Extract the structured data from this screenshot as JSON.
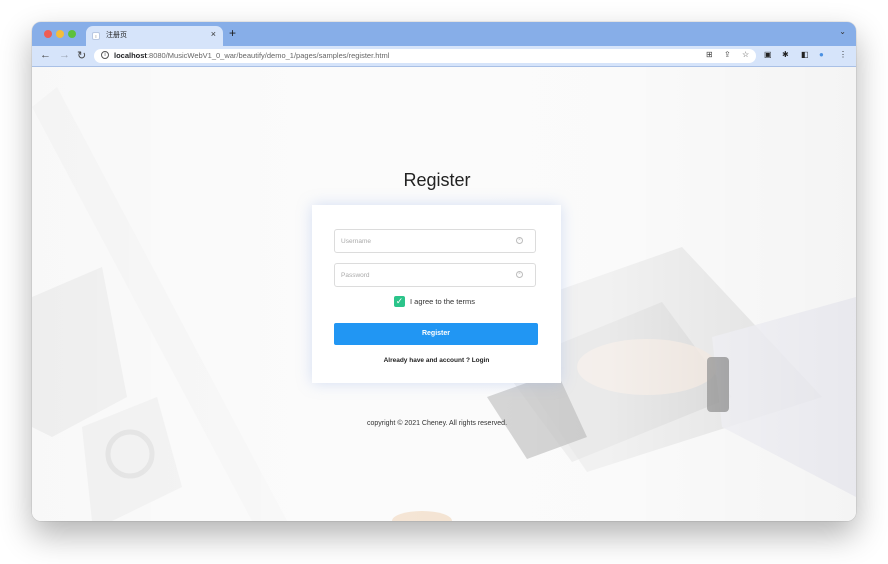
{
  "browser": {
    "tab_title": "注册页",
    "tab_close": "×",
    "new_tab": "+",
    "url_host": "localhost",
    "url_rest": ":8080/MusicWebV1_0_war/beautify/demo_1/pages/samples/register.html"
  },
  "page": {
    "heading": "Register",
    "username_placeholder": "Username",
    "password_placeholder": "Password",
    "terms_label": "I agree to the terms",
    "terms_checked": true,
    "register_button": "Register",
    "login_prompt": "Already have and account ? Login",
    "copyright": "copyright © 2021 Cheney. All rights reserved."
  },
  "colors": {
    "accent": "#2196f3",
    "checkbox": "#2bc48a",
    "tabbar": "#87aee8",
    "toolbar": "#d6e4fa"
  }
}
